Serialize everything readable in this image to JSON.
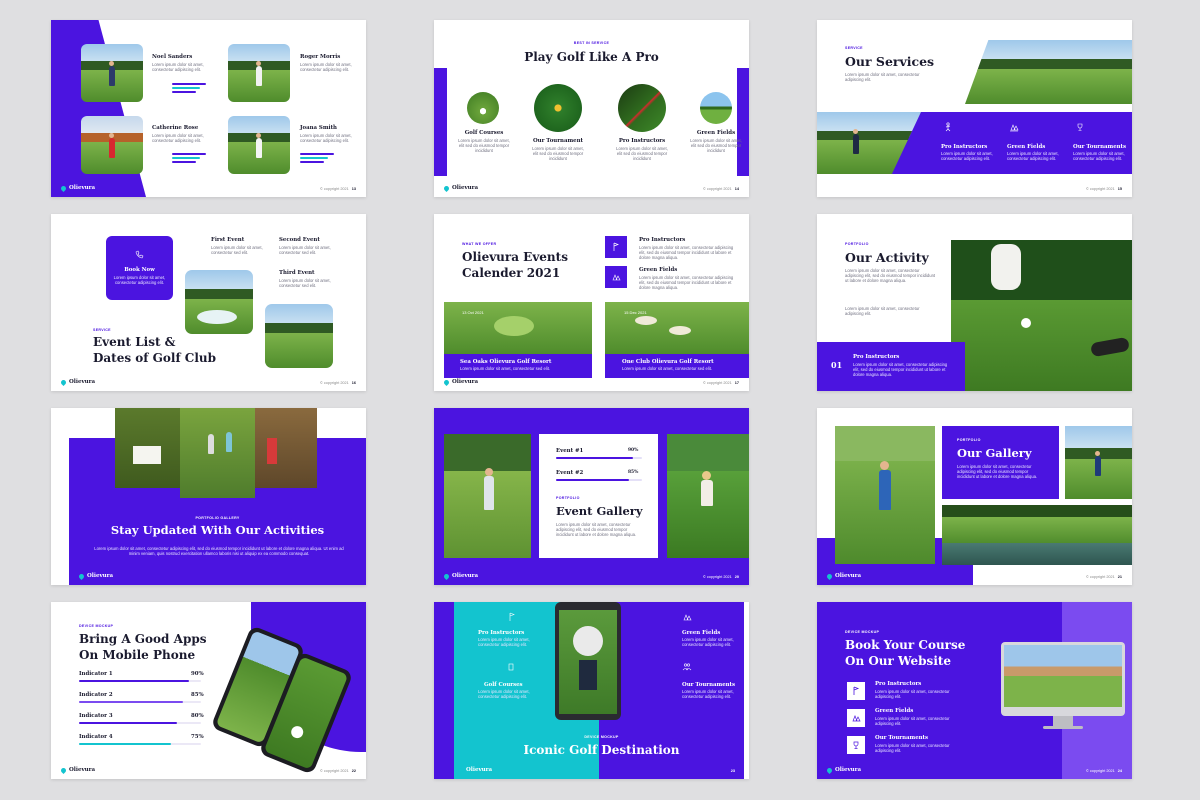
{
  "brand": "Olievura",
  "copyright": "© copyright 2021",
  "lorem_short": "Lorem ipsum dolor sit amet, consectetur adipiscing elit.",
  "lorem_short2": "Lorem ipsum dolor sit amet, consectetur sed elit.",
  "lorem_card": "Lorem ipsum dolor sit amet, elit sed do eiusmod tempor incididunt",
  "lorem_long": "Lorem ipsum dolor sit amet, consectetur adipiscing elit, sed do eiusmod tempor incididunt ut labore et dolore magna aliqua. Ut enim ad minim veniam, quis nostrud exercitation ullamco laboris nisi ut aliquip ex ea commodo consequat.",
  "lorem_para": "Lorem ipsum dolor sit amet, consectetur adipiscing elit, sed do eiusmod tempor incididunt ut labore et dolore magna aliqua.",
  "colors": {
    "purple": "#4b14e0",
    "cyan": "#13c4cf",
    "light_purple": "#7b4bf0"
  },
  "slides": {
    "s13": {
      "page": "13",
      "people": [
        {
          "name": "Noel Sanders"
        },
        {
          "name": "Roger Morris"
        },
        {
          "name": "Catherine Rose"
        },
        {
          "name": "Joana Smith"
        }
      ]
    },
    "s14": {
      "page": "14",
      "label": "BEST IN SERVICE",
      "title": "Play Golf Like A Pro",
      "items": [
        "Golf Courses",
        "Our Tournament",
        "Pro Instructors",
        "Green Fields"
      ]
    },
    "s15": {
      "page": "15",
      "label": "SERVICE",
      "title": "Our Services",
      "items": [
        "Pro Instructors",
        "Green Fields",
        "Our Tournaments"
      ]
    },
    "s16": {
      "page": "16",
      "book_label": "Book Now",
      "label": "SERVICE",
      "title_line1": "Event List &",
      "title_line2": "Dates of Golf Club",
      "events": [
        "First Event",
        "Second Event",
        "Third Event"
      ]
    },
    "s17": {
      "page": "17",
      "label": "WHAT WE OFFER",
      "title_line1": "Olievura Events",
      "title_line2": "Calender 2021",
      "features": [
        "Pro Instructors",
        "Green Fields"
      ],
      "cards": [
        {
          "date": "13 Oct 2021",
          "name": "Sea Oaks Olievura Golf Resort"
        },
        {
          "date": "15 Dec 2021",
          "name": "One Club Olievura Golf Resort"
        }
      ]
    },
    "s18": {
      "page": "18",
      "label": "PORTFOLIO",
      "title": "Our Activity",
      "num": "01",
      "item": "Pro Instructors"
    },
    "s19": {
      "label": "PORTFOLIO GALLERY",
      "title": "Stay Updated With Our Activities"
    },
    "s20": {
      "page": "20",
      "events": [
        {
          "name": "Event #1",
          "pct": "90%",
          "value": 0.9
        },
        {
          "name": "Event #2",
          "pct": "85%",
          "value": 0.85
        }
      ],
      "label": "PORTFOLIO",
      "title": "Event Gallery"
    },
    "s21": {
      "page": "21",
      "label": "PORTFOLIO",
      "title": "Our Gallery"
    },
    "s22": {
      "page": "22",
      "label": "DEVICE MOCKUP",
      "title_line1": "Bring A Good Apps",
      "title_line2": "On Mobile Phone",
      "indicators": [
        {
          "name": "Indicator 1",
          "pct": "90%",
          "value": 0.9,
          "color": "#4b14e0"
        },
        {
          "name": "Indicator 2",
          "pct": "85%",
          "value": 0.85,
          "color": "#7b4bf0"
        },
        {
          "name": "Indicator 3",
          "pct": "80%",
          "value": 0.8,
          "color": "#4b14e0"
        },
        {
          "name": "Indicator 4",
          "pct": "75%",
          "value": 0.75,
          "color": "#13c4cf"
        }
      ]
    },
    "s23": {
      "page": "23",
      "left": [
        "Pro Instructors",
        "Golf Courses"
      ],
      "right": [
        "Green Fields",
        "Our Tournaments"
      ],
      "label": "DEVICE MOCKUP",
      "title": "Iconic Golf Destination"
    },
    "s24": {
      "page": "24",
      "label": "DEVICE MOCKUP",
      "title_line1": "Book Your Course",
      "title_line2": "On Our Website",
      "items": [
        "Pro Instructors",
        "Green Fields",
        "Our Tournaments"
      ]
    }
  }
}
